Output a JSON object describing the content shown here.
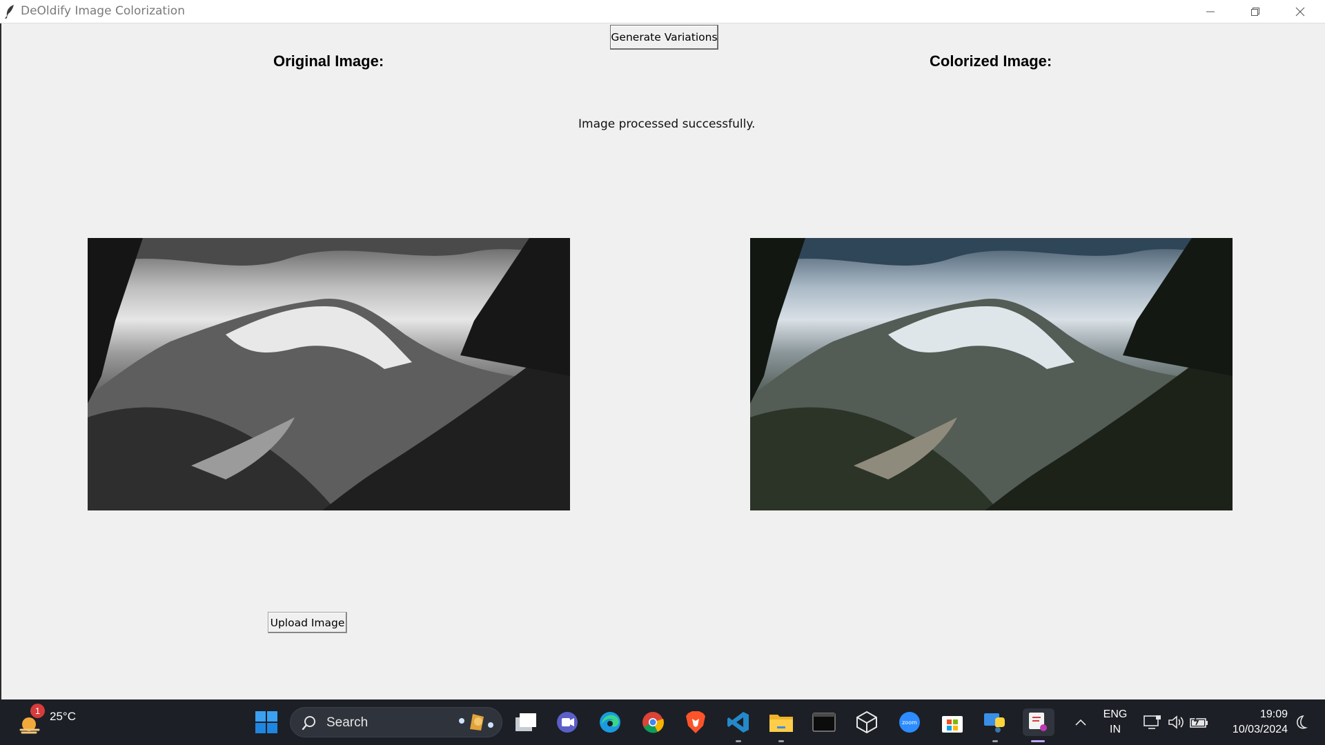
{
  "window": {
    "title": "DeOldify Image Colorization",
    "controls": [
      "minimize",
      "restore",
      "close"
    ]
  },
  "main": {
    "generate_button_label": "Generate Variations",
    "original_heading": "Original Image:",
    "colorized_heading": "Colorized Image:",
    "status_text": "Image processed successfully.",
    "upload_button_label": "Upload Image",
    "images": {
      "original": {
        "description_icon": "grayscale-mountain-photo"
      },
      "colorized": {
        "description_icon": "colorized-mountain-photo"
      }
    }
  },
  "taskbar": {
    "weather_badge": "1",
    "temperature": "25°C",
    "search_label": "Search",
    "pinned_apps": [
      "start-icon",
      "search-icon",
      "task-view-icon",
      "teams-icon",
      "edge-icon",
      "chrome-icon",
      "brave-icon",
      "vscode-icon",
      "file-explorer-icon",
      "terminal-icon",
      "cube-app-icon",
      "zoom-icon",
      "microsoft-store-icon",
      "python-icon",
      "snipping-tool-icon"
    ],
    "lang_line1": "ENG",
    "lang_line2": "IN",
    "time": "19:09",
    "date": "10/03/2024"
  },
  "colors": {
    "window_bg": "#f0f0f0",
    "taskbar_bg": "#1c1f26",
    "windows_blue": "#0a84ff"
  }
}
